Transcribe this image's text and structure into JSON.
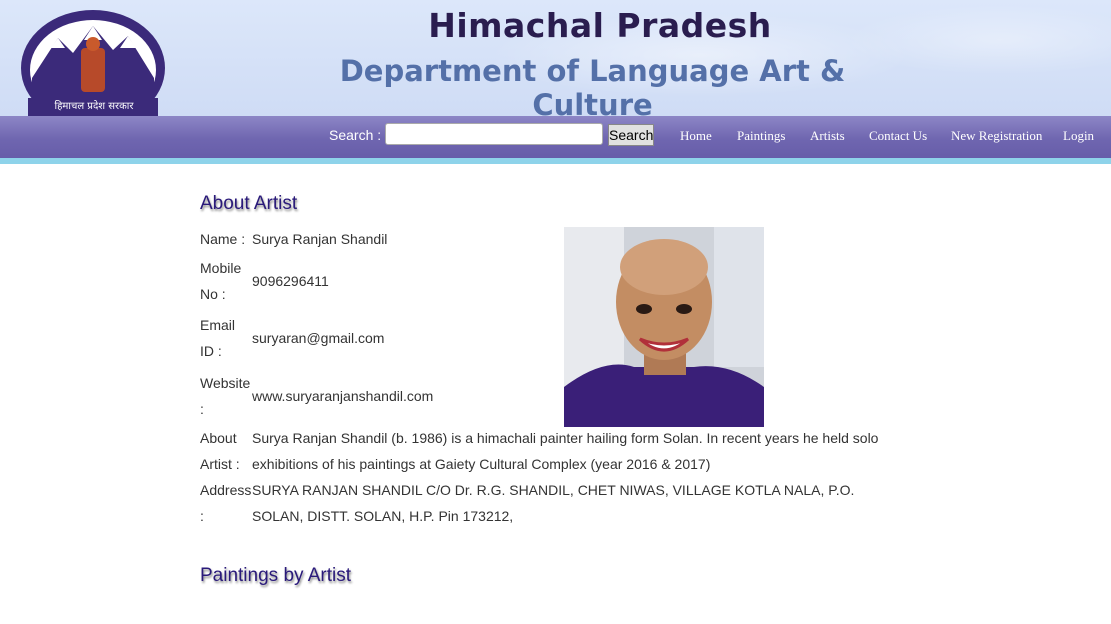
{
  "header": {
    "logo_caption": "हिमाचल प्रदेश सरकार",
    "title": "Himachal Pradesh",
    "subtitle": "Department of Language Art & Culture"
  },
  "nav": {
    "search_label": "Search :",
    "search_value": "",
    "search_button": "Search",
    "links": [
      "Home",
      "Paintings",
      "Artists",
      "Contact Us",
      "New Registration",
      "Login"
    ]
  },
  "about": {
    "heading": "About Artist",
    "name_label": "Name :",
    "name": "Surya Ranjan Shandil",
    "mobile_label_1": "Mobile",
    "mobile_label_2": "No :",
    "mobile": "9096296411",
    "email_label_1": "Email",
    "email_label_2": "ID :",
    "email": "suryaran@gmail.com",
    "website_label_1": "Website",
    "website_label_2": ":",
    "website": "www.suryaranjanshandil.com",
    "about_label_1": "About",
    "about_label_2": "Artist :",
    "about_line_1": "Surya Ranjan Shandil (b. 1986) is a himachali painter hailing form Solan. In recent years he held solo",
    "about_line_2": "exhibitions of his paintings at Gaiety Cultural Complex (year 2016 & 2017)",
    "address_label_1": "Address",
    "address_label_2": ":",
    "address_line_1": "SURYA RANJAN SHANDIL C/O Dr. R.G. SHANDIL, CHET NIWAS, VILLAGE KOTLA NALA, P.O.",
    "address_line_2": "SOLAN, DISTT. SOLAN, H.P. Pin 173212,"
  },
  "paintings": {
    "heading": "Paintings by Artist"
  },
  "colors": {
    "nav_bar": "#6f66b0",
    "nav_stripe": "#8ed3ea",
    "heading": "#2a1a7a",
    "title": "#2a1d4f",
    "subtitle": "#5470a8"
  }
}
